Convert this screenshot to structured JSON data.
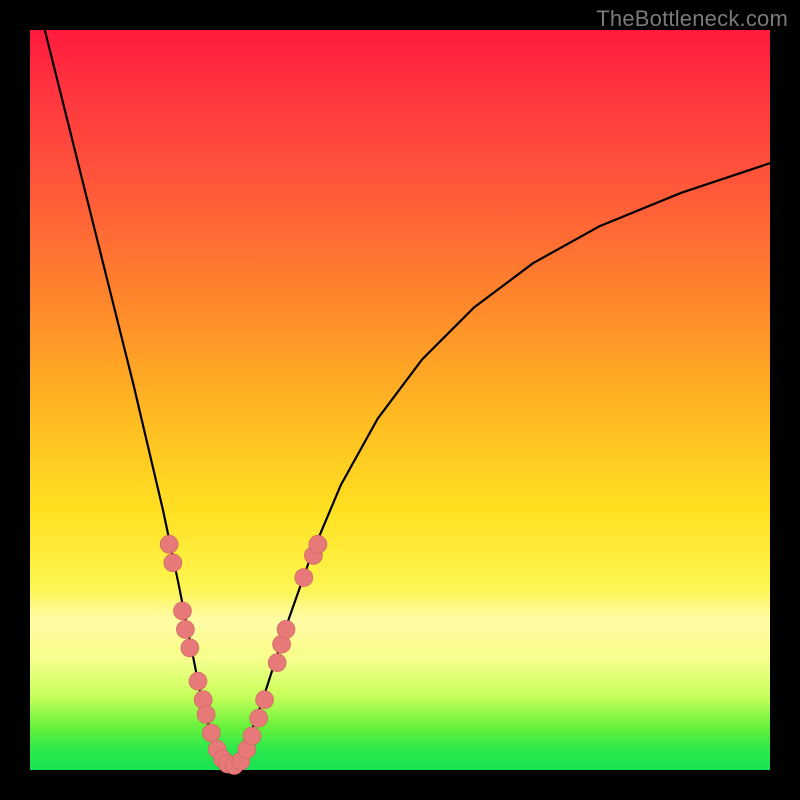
{
  "watermark": "TheBottleneck.com",
  "colors": {
    "dot_fill": "#e77a78",
    "dot_stroke": "#c9615e",
    "curve": "#000000"
  },
  "chart_data": {
    "type": "line",
    "title": "",
    "xlabel": "",
    "ylabel": "",
    "xlim": [
      0,
      100
    ],
    "ylim": [
      0,
      100
    ],
    "curve_left": {
      "x": [
        2,
        4,
        6,
        8,
        10,
        12,
        14,
        16,
        18,
        20,
        21,
        22,
        23,
        24,
        25,
        26,
        27
      ],
      "y": [
        100,
        92,
        84,
        76,
        68,
        60,
        52,
        43.5,
        35,
        25.5,
        20.5,
        15.5,
        10.5,
        6.5,
        3.5,
        1.5,
        0.5
      ]
    },
    "curve_right": {
      "x": [
        27,
        28,
        29,
        30,
        31,
        32,
        33,
        35,
        38,
        42,
        47,
        53,
        60,
        68,
        77,
        88,
        100
      ],
      "y": [
        0.5,
        1.5,
        3.2,
        5.5,
        8.2,
        11.2,
        14.3,
        20.5,
        29,
        38.5,
        47.5,
        55.5,
        62.5,
        68.5,
        73.5,
        78,
        82
      ]
    },
    "dots_left": [
      {
        "x": 18.8,
        "y": 30.5
      },
      {
        "x": 19.3,
        "y": 28.0
      },
      {
        "x": 20.6,
        "y": 21.5
      },
      {
        "x": 21.0,
        "y": 19.0
      },
      {
        "x": 21.6,
        "y": 16.5
      },
      {
        "x": 22.7,
        "y": 12.0
      },
      {
        "x": 23.4,
        "y": 9.5
      },
      {
        "x": 23.8,
        "y": 7.5
      },
      {
        "x": 24.5,
        "y": 5.0
      },
      {
        "x": 25.3,
        "y": 2.8
      },
      {
        "x": 26.0,
        "y": 1.5
      },
      {
        "x": 26.7,
        "y": 0.8
      },
      {
        "x": 27.6,
        "y": 0.6
      }
    ],
    "dots_right": [
      {
        "x": 28.5,
        "y": 1.2
      },
      {
        "x": 29.3,
        "y": 2.8
      },
      {
        "x": 30.0,
        "y": 4.6
      },
      {
        "x": 30.9,
        "y": 7.0
      },
      {
        "x": 31.7,
        "y": 9.5
      },
      {
        "x": 33.4,
        "y": 14.5
      },
      {
        "x": 34.0,
        "y": 17.0
      },
      {
        "x": 34.6,
        "y": 19.0
      },
      {
        "x": 37.0,
        "y": 26.0
      },
      {
        "x": 38.3,
        "y": 29.0
      },
      {
        "x": 38.9,
        "y": 30.5
      }
    ]
  }
}
